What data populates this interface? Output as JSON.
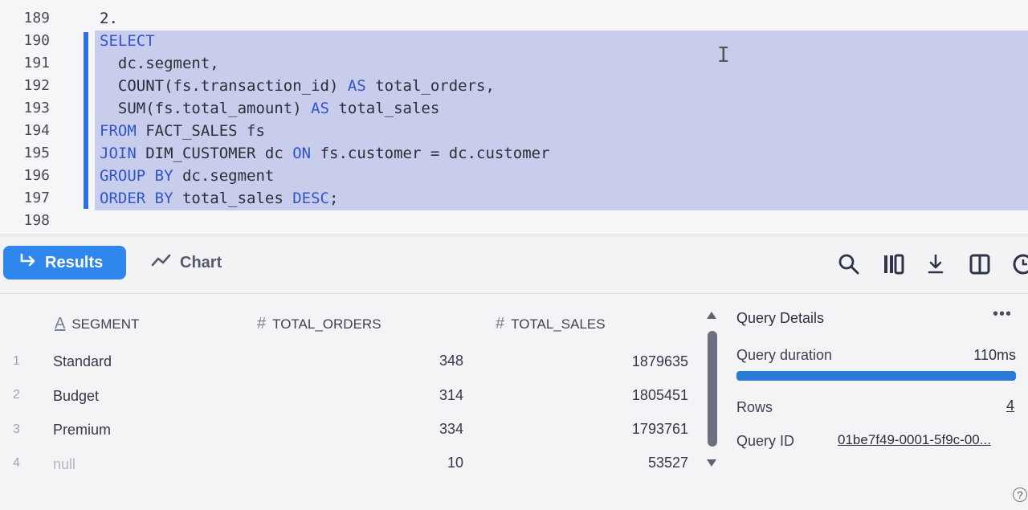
{
  "editor": {
    "lines": [
      {
        "num": "189",
        "code": "2."
      },
      {
        "num": "190",
        "code": "SELECT"
      },
      {
        "num": "191",
        "code": "  dc.segment,"
      },
      {
        "num": "192",
        "code": "  COUNT(fs.transaction_id) AS total_orders,"
      },
      {
        "num": "193",
        "code": "  SUM(fs.total_amount) AS total_sales"
      },
      {
        "num": "194",
        "code": "FROM FACT_SALES fs"
      },
      {
        "num": "195",
        "code": "JOIN DIM_CUSTOMER dc ON fs.customer = dc.customer"
      },
      {
        "num": "196",
        "code": "GROUP BY dc.segment"
      },
      {
        "num": "197",
        "code": "ORDER BY total_sales DESC;"
      },
      {
        "num": "198",
        "code": ""
      }
    ],
    "text_cursor_icon": "i-beam-icon"
  },
  "tabs": {
    "results": "Results",
    "chart": "Chart"
  },
  "toolbar_icons": [
    "search-icon",
    "columns-icon",
    "download-icon",
    "split-panel-icon",
    "history-icon"
  ],
  "grid": {
    "columns": [
      {
        "label": "SEGMENT",
        "type_icon": "text-type-icon"
      },
      {
        "label": "TOTAL_ORDERS",
        "type_icon": "number-type-icon"
      },
      {
        "label": "TOTAL_SALES",
        "type_icon": "number-type-icon"
      }
    ],
    "rows": [
      {
        "idx": "1",
        "segment": "Standard",
        "total_orders": "348",
        "total_sales": "1879635"
      },
      {
        "idx": "2",
        "segment": "Budget",
        "total_orders": "314",
        "total_sales": "1805451"
      },
      {
        "idx": "3",
        "segment": "Premium",
        "total_orders": "334",
        "total_sales": "1793761"
      },
      {
        "idx": "4",
        "segment": "null",
        "total_orders": "10",
        "total_sales": "53527"
      }
    ]
  },
  "details": {
    "title": "Query Details",
    "more": "•••",
    "duration_label": "Query duration",
    "duration_value": "110ms",
    "rows_label": "Rows",
    "rows_value": "4",
    "query_id_label": "Query ID",
    "query_id_value": "01be7f49-0001-5f9c-00..."
  },
  "colors": {
    "accent": "#2f86ec",
    "keyword": "#2e56c9",
    "selection": "#c9cdec"
  }
}
